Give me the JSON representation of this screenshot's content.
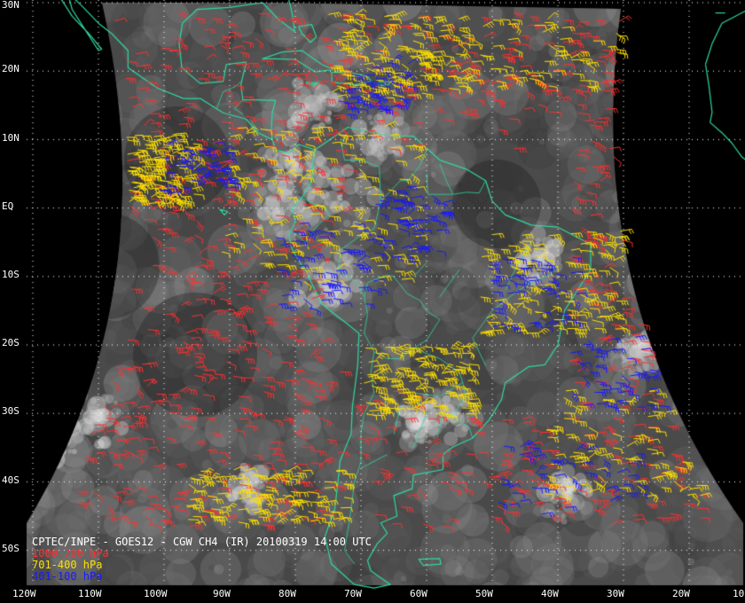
{
  "title": "CPTEC/INPE - GOES12 - CGW CH4 (IR) 20100319 14:00 UTC",
  "legend": [
    {
      "label": "1000-700 hPa",
      "color": "#ff3030"
    },
    {
      "label": "701-400 hPa",
      "color": "#ffe000"
    },
    {
      "label": "401-100 hPa",
      "color": "#1818ff"
    }
  ],
  "lat_labels": [
    "30N",
    "20N",
    "10N",
    "EQ",
    "10S",
    "20S",
    "30S",
    "40S",
    "50S"
  ],
  "lon_labels": [
    "120W",
    "110W",
    "100W",
    "90W",
    "80W",
    "70W",
    "60W",
    "50W",
    "40W",
    "30W",
    "20W",
    "10"
  ],
  "colors": {
    "coastline": "#2fd8a0",
    "grid": "#ffffff",
    "background": "#000000"
  }
}
